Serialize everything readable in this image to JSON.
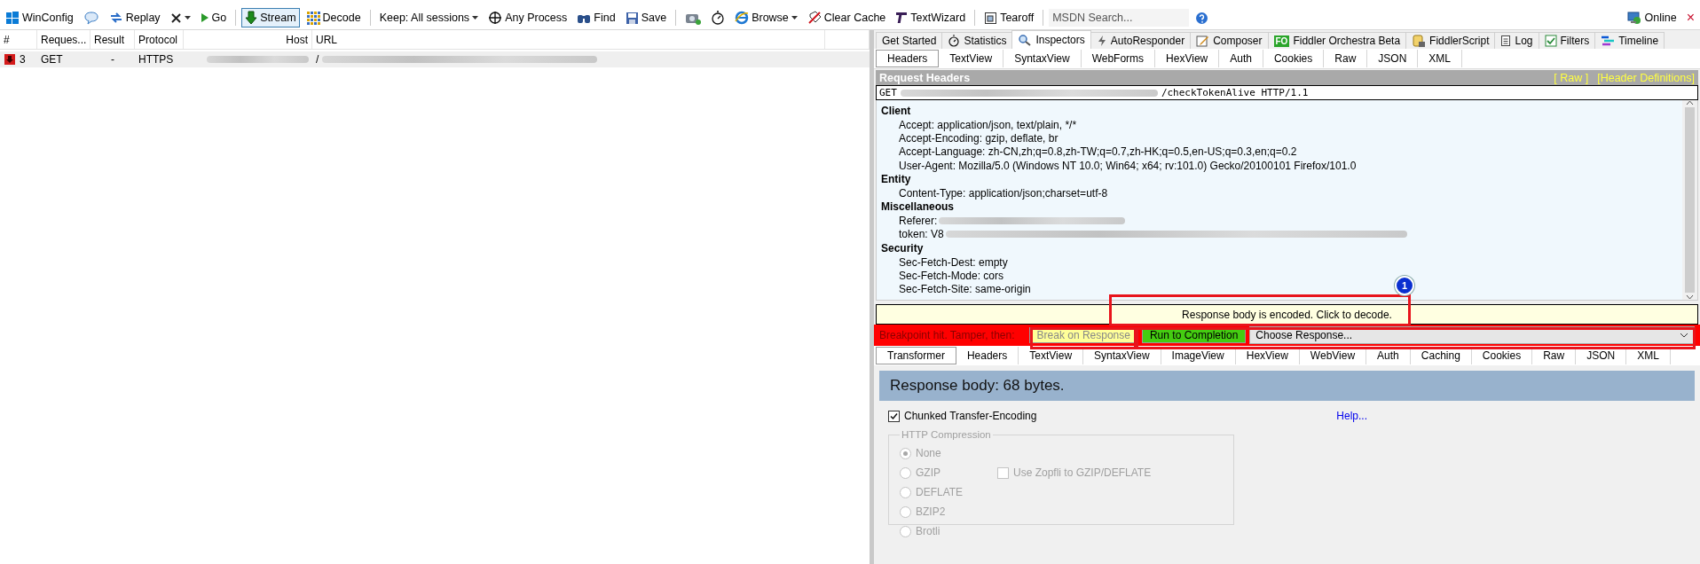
{
  "toolbar": {
    "items": [
      {
        "kind": "button",
        "label": "WinConfig"
      },
      {
        "kind": "icon-button"
      },
      {
        "kind": "button",
        "label": "Replay"
      },
      {
        "kind": "icon-menu"
      },
      {
        "kind": "button",
        "label": "Go"
      },
      {
        "kind": "separator"
      },
      {
        "kind": "toggle",
        "label": "Stream",
        "pressed": true
      },
      {
        "kind": "toggle",
        "label": "Decode",
        "pressed": false
      },
      {
        "kind": "separator"
      },
      {
        "kind": "menu",
        "label": "Keep: All sessions"
      },
      {
        "kind": "button",
        "label": "Any Process"
      },
      {
        "kind": "button",
        "label": "Find"
      },
      {
        "kind": "button",
        "label": "Save"
      },
      {
        "kind": "separator"
      },
      {
        "kind": "icon-button"
      },
      {
        "kind": "icon-button"
      },
      {
        "kind": "menu",
        "label": "Browse"
      },
      {
        "kind": "button",
        "label": "Clear Cache"
      },
      {
        "kind": "button",
        "label": "TextWizard"
      },
      {
        "kind": "separator"
      },
      {
        "kind": "button",
        "label": "Tearoff"
      },
      {
        "kind": "separator"
      },
      {
        "kind": "search",
        "placeholder": "MSDN Search..."
      },
      {
        "kind": "icon-button"
      }
    ],
    "status": "Online",
    "close": "×"
  },
  "sessions": {
    "columns": [
      "#",
      "Reques...",
      "Result",
      "Protocol",
      "Host",
      "URL"
    ],
    "rows": [
      {
        "id": "3",
        "method": "GET",
        "result": "-",
        "protocol": "HTTPS",
        "url": "/"
      }
    ]
  },
  "inspector_tabs": [
    {
      "label": "Get Started",
      "selected": false
    },
    {
      "label": "Statistics",
      "selected": false
    },
    {
      "label": "Inspectors",
      "selected": true
    },
    {
      "label": "AutoResponder",
      "selected": false
    },
    {
      "label": "Composer",
      "selected": false
    },
    {
      "label": "Fiddler Orchestra Beta",
      "badge": "FO",
      "selected": false
    },
    {
      "label": "FiddlerScript",
      "selected": false
    },
    {
      "label": "Log",
      "selected": false
    },
    {
      "label": "Filters",
      "selected": false
    },
    {
      "label": "Timeline",
      "selected": false
    }
  ],
  "request": {
    "tabs": [
      {
        "label": "Headers",
        "selected": true
      },
      {
        "label": "TextView",
        "selected": false
      },
      {
        "label": "SyntaxView",
        "selected": false
      },
      {
        "label": "WebForms",
        "selected": false
      },
      {
        "label": "HexView",
        "selected": false
      },
      {
        "label": "Auth",
        "selected": false
      },
      {
        "label": "Cookies",
        "selected": false
      },
      {
        "label": "Raw",
        "selected": false
      },
      {
        "label": "JSON",
        "selected": false
      },
      {
        "label": "XML",
        "selected": false
      }
    ],
    "title": "Request Headers",
    "links": [
      "[ Raw ]",
      "[Header Definitions]"
    ],
    "request_line": {
      "method": "GET",
      "rest": "/checkTokenAlive HTTP/1.1"
    },
    "groups": [
      {
        "name": "Client",
        "headers": [
          {
            "text": "Accept: application/json, text/plain, */*",
            "redacted": false
          },
          {
            "text": "Accept-Encoding: gzip, deflate, br",
            "redacted": false
          },
          {
            "text": "Accept-Language: zh-CN,zh;q=0.8,zh-TW;q=0.7,zh-HK;q=0.5,en-US;q=0.3,en;q=0.2",
            "redacted": false
          },
          {
            "text": "User-Agent: Mozilla/5.0 (Windows NT 10.0; Win64; x64; rv:101.0) Gecko/20100101 Firefox/101.0",
            "redacted": false
          }
        ]
      },
      {
        "name": "Entity",
        "headers": [
          {
            "text": "Content-Type: application/json;charset=utf-8",
            "redacted": false
          }
        ]
      },
      {
        "name": "Miscellaneous",
        "headers": [
          {
            "text": "Referer:",
            "redacted": true
          },
          {
            "text": "token: V8",
            "redacted": true
          }
        ]
      },
      {
        "name": "Security",
        "headers": [
          {
            "text": "Sec-Fetch-Dest: empty",
            "redacted": false
          },
          {
            "text": "Sec-Fetch-Mode: cors",
            "redacted": false
          },
          {
            "text": "Sec-Fetch-Site: same-origin",
            "redacted": false
          }
        ]
      }
    ]
  },
  "notification": "Response body is encoded. Click to decode.",
  "breakpoint": {
    "label": "Breakpoint hit. Tamper, then:",
    "buttons": [
      {
        "label": "Break on Response",
        "disabled": true
      },
      {
        "label": "Run to Completion",
        "disabled": false
      }
    ],
    "select": "Choose Response..."
  },
  "response": {
    "tabs": [
      {
        "label": "Transformer",
        "selected": true
      },
      {
        "label": "Headers",
        "selected": false
      },
      {
        "label": "TextView",
        "selected": false
      },
      {
        "label": "SyntaxView",
        "selected": false
      },
      {
        "label": "ImageView",
        "selected": false
      },
      {
        "label": "HexView",
        "selected": false
      },
      {
        "label": "WebView",
        "selected": false
      },
      {
        "label": "Auth",
        "selected": false
      },
      {
        "label": "Caching",
        "selected": false
      },
      {
        "label": "Cookies",
        "selected": false
      },
      {
        "label": "Raw",
        "selected": false
      },
      {
        "label": "JSON",
        "selected": false
      },
      {
        "label": "XML",
        "selected": false
      }
    ],
    "body": "Response body: 68 bytes.",
    "chunked": {
      "label": "Chunked Transfer-Encoding",
      "checked": true
    },
    "help": "Help...",
    "compression": {
      "title": "HTTP Compression",
      "disabled": true,
      "options": [
        {
          "label": "None",
          "selected": true
        },
        {
          "label": "GZIP",
          "selected": false
        },
        {
          "label": "DEFLATE",
          "selected": false
        },
        {
          "label": "BZIP2",
          "selected": false
        },
        {
          "label": "Brotli",
          "selected": false
        }
      ],
      "zopfli": {
        "label": "Use Zopfli to GZIP/DEFLATE",
        "checked": false
      }
    }
  },
  "annotation": {
    "marker": "1"
  }
}
